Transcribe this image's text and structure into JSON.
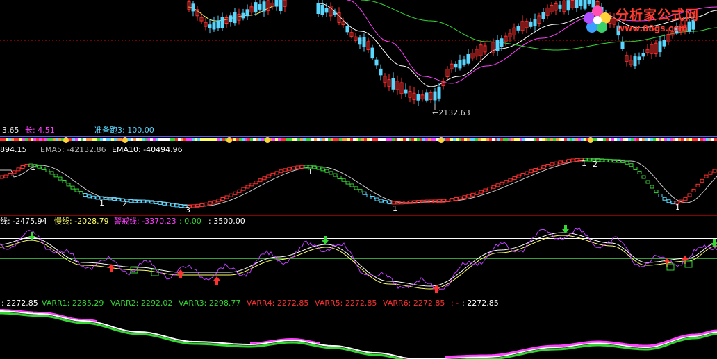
{
  "watermark": {
    "title": "分析家公式网",
    "url": "www.88gs.com"
  },
  "colors": {
    "bg": "#000000",
    "grid": "#7a0000",
    "red": "#ff3030",
    "green": "#33d833",
    "cyan": "#5ad7ff",
    "white": "#ffffff",
    "yellow": "#ffff66",
    "magenta": "#ff40ff",
    "olive": "#7fa030",
    "orange": "#ff9a40"
  },
  "panel1": {
    "low_marker": "←2132.63"
  },
  "panel2": {
    "fields": [
      {
        "text": "3.65",
        "color": "#e8e8e8"
      },
      {
        "text": "长: 4.51",
        "color": "#ff40ff"
      },
      {
        "text": "准备跑3: 100.00",
        "color": "#5ad7ff"
      }
    ]
  },
  "panel3": {
    "fields": [
      {
        "text": "894.15",
        "color": "#ffffff"
      },
      {
        "text": "EMA5: -42132.86",
        "color": "#b0b0b0"
      },
      {
        "text": "EMA10: -40494.96",
        "color": "#ffffff"
      }
    ],
    "numbers": [
      "1",
      "1",
      "2",
      "3",
      "1",
      "1",
      "1",
      "2",
      "1"
    ]
  },
  "panel4": {
    "fields": [
      {
        "text": "线: -2475.94",
        "color": "#ffffff"
      },
      {
        "text": "慢线: -2028.79",
        "color": "#ffff66"
      },
      {
        "text": "警戒线: -3370.23",
        "color": "#ff40ff"
      },
      {
        "text": ": 0.00",
        "color": "#33d833"
      },
      {
        "text": ": 3500.00",
        "color": "#ffffff"
      }
    ]
  },
  "panel5": {
    "fields": [
      {
        "text": ": 2272.85",
        "color": "#ffffff"
      },
      {
        "text": "VARR1: 2285.29",
        "color": "#33d833"
      },
      {
        "text": "VARR2: 2292.02",
        "color": "#33d833"
      },
      {
        "text": "VARR3: 2298.77",
        "color": "#33d833"
      },
      {
        "text": "VARR4: 2272.85",
        "color": "#ff3030"
      },
      {
        "text": "VARR5: 2272.85",
        "color": "#ff3030"
      },
      {
        "text": "VARR6: 2272.85",
        "color": "#ff3030"
      },
      {
        "text": ": -",
        "color": "#ff3030"
      },
      {
        "text": ": 2272.85",
        "color": "#ffffff"
      }
    ]
  },
  "chart_data": [
    {
      "type": "candlestick",
      "title": "",
      "annotations": [
        "←2132.63"
      ],
      "min_value": 2132.63
    },
    {
      "type": "bar",
      "series": [
        {
          "name": "长",
          "values": [
            4.51
          ]
        },
        {
          "name": "准备跑3",
          "values": [
            100.0
          ]
        }
      ]
    },
    {
      "type": "line",
      "series": [
        {
          "name": "EMA5",
          "values": [
            -42132.86
          ]
        },
        {
          "name": "EMA10",
          "values": [
            -40494.96
          ]
        }
      ]
    },
    {
      "type": "line",
      "series": [
        {
          "name": "慢线",
          "values": [
            -2028.79
          ]
        },
        {
          "name": "警戒线",
          "values": [
            -3370.23
          ]
        }
      ],
      "reference_lines": [
        0.0,
        3500.0
      ]
    },
    {
      "type": "line",
      "series": [
        {
          "name": "VARR1",
          "values": [
            2285.29
          ]
        },
        {
          "name": "VARR2",
          "values": [
            2292.02
          ]
        },
        {
          "name": "VARR3",
          "values": [
            2298.77
          ]
        },
        {
          "name": "VARR4",
          "values": [
            2272.85
          ]
        },
        {
          "name": "VARR5",
          "values": [
            2272.85
          ]
        },
        {
          "name": "VARR6",
          "values": [
            2272.85
          ]
        }
      ]
    }
  ]
}
